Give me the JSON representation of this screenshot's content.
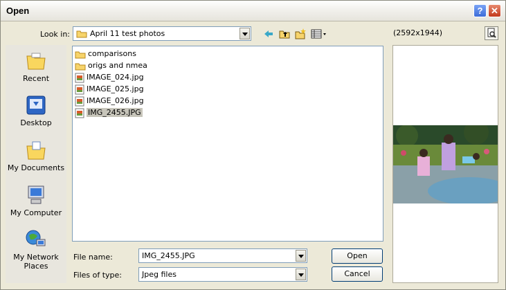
{
  "window": {
    "title": "Open"
  },
  "titlebar": {
    "help_label": "?",
    "close_label": "✕"
  },
  "lookin": {
    "label": "Look in:",
    "value": "April 11 test photos"
  },
  "toolbar": {
    "icons": [
      "back-arrow-icon",
      "up-folder-icon",
      "new-folder-icon",
      "views-menu-icon"
    ]
  },
  "places": [
    {
      "label": "Recent",
      "icon": "recent-folder-icon"
    },
    {
      "label": "Desktop",
      "icon": "desktop-icon"
    },
    {
      "label": "My Documents",
      "icon": "my-documents-icon"
    },
    {
      "label": "My Computer",
      "icon": "my-computer-icon"
    },
    {
      "label": "My Network Places",
      "icon": "network-places-icon"
    }
  ],
  "files": [
    {
      "name": "comparisons",
      "type": "folder"
    },
    {
      "name": "origs and nmea",
      "type": "folder"
    },
    {
      "name": "IMAGE_024.jpg",
      "type": "image"
    },
    {
      "name": "IMAGE_025.jpg",
      "type": "image"
    },
    {
      "name": "IMAGE_026.jpg",
      "type": "image"
    },
    {
      "name": "IMG_2455.JPG",
      "type": "image",
      "selected": true
    }
  ],
  "form": {
    "filename_label": "File name:",
    "filename_value": "IMG_2455.JPG",
    "filetype_label": "Files of type:",
    "filetype_value": "Jpeg files",
    "open_label": "Open",
    "cancel_label": "Cancel"
  },
  "preview": {
    "resolution": "(2592x1944)"
  },
  "colors": {
    "title_bg": "#f3f2ee",
    "dialog_bg": "#ece9d8",
    "border_blue": "#7f9db9",
    "close_red": "#c23a1c",
    "help_blue": "#3c6cd8"
  }
}
